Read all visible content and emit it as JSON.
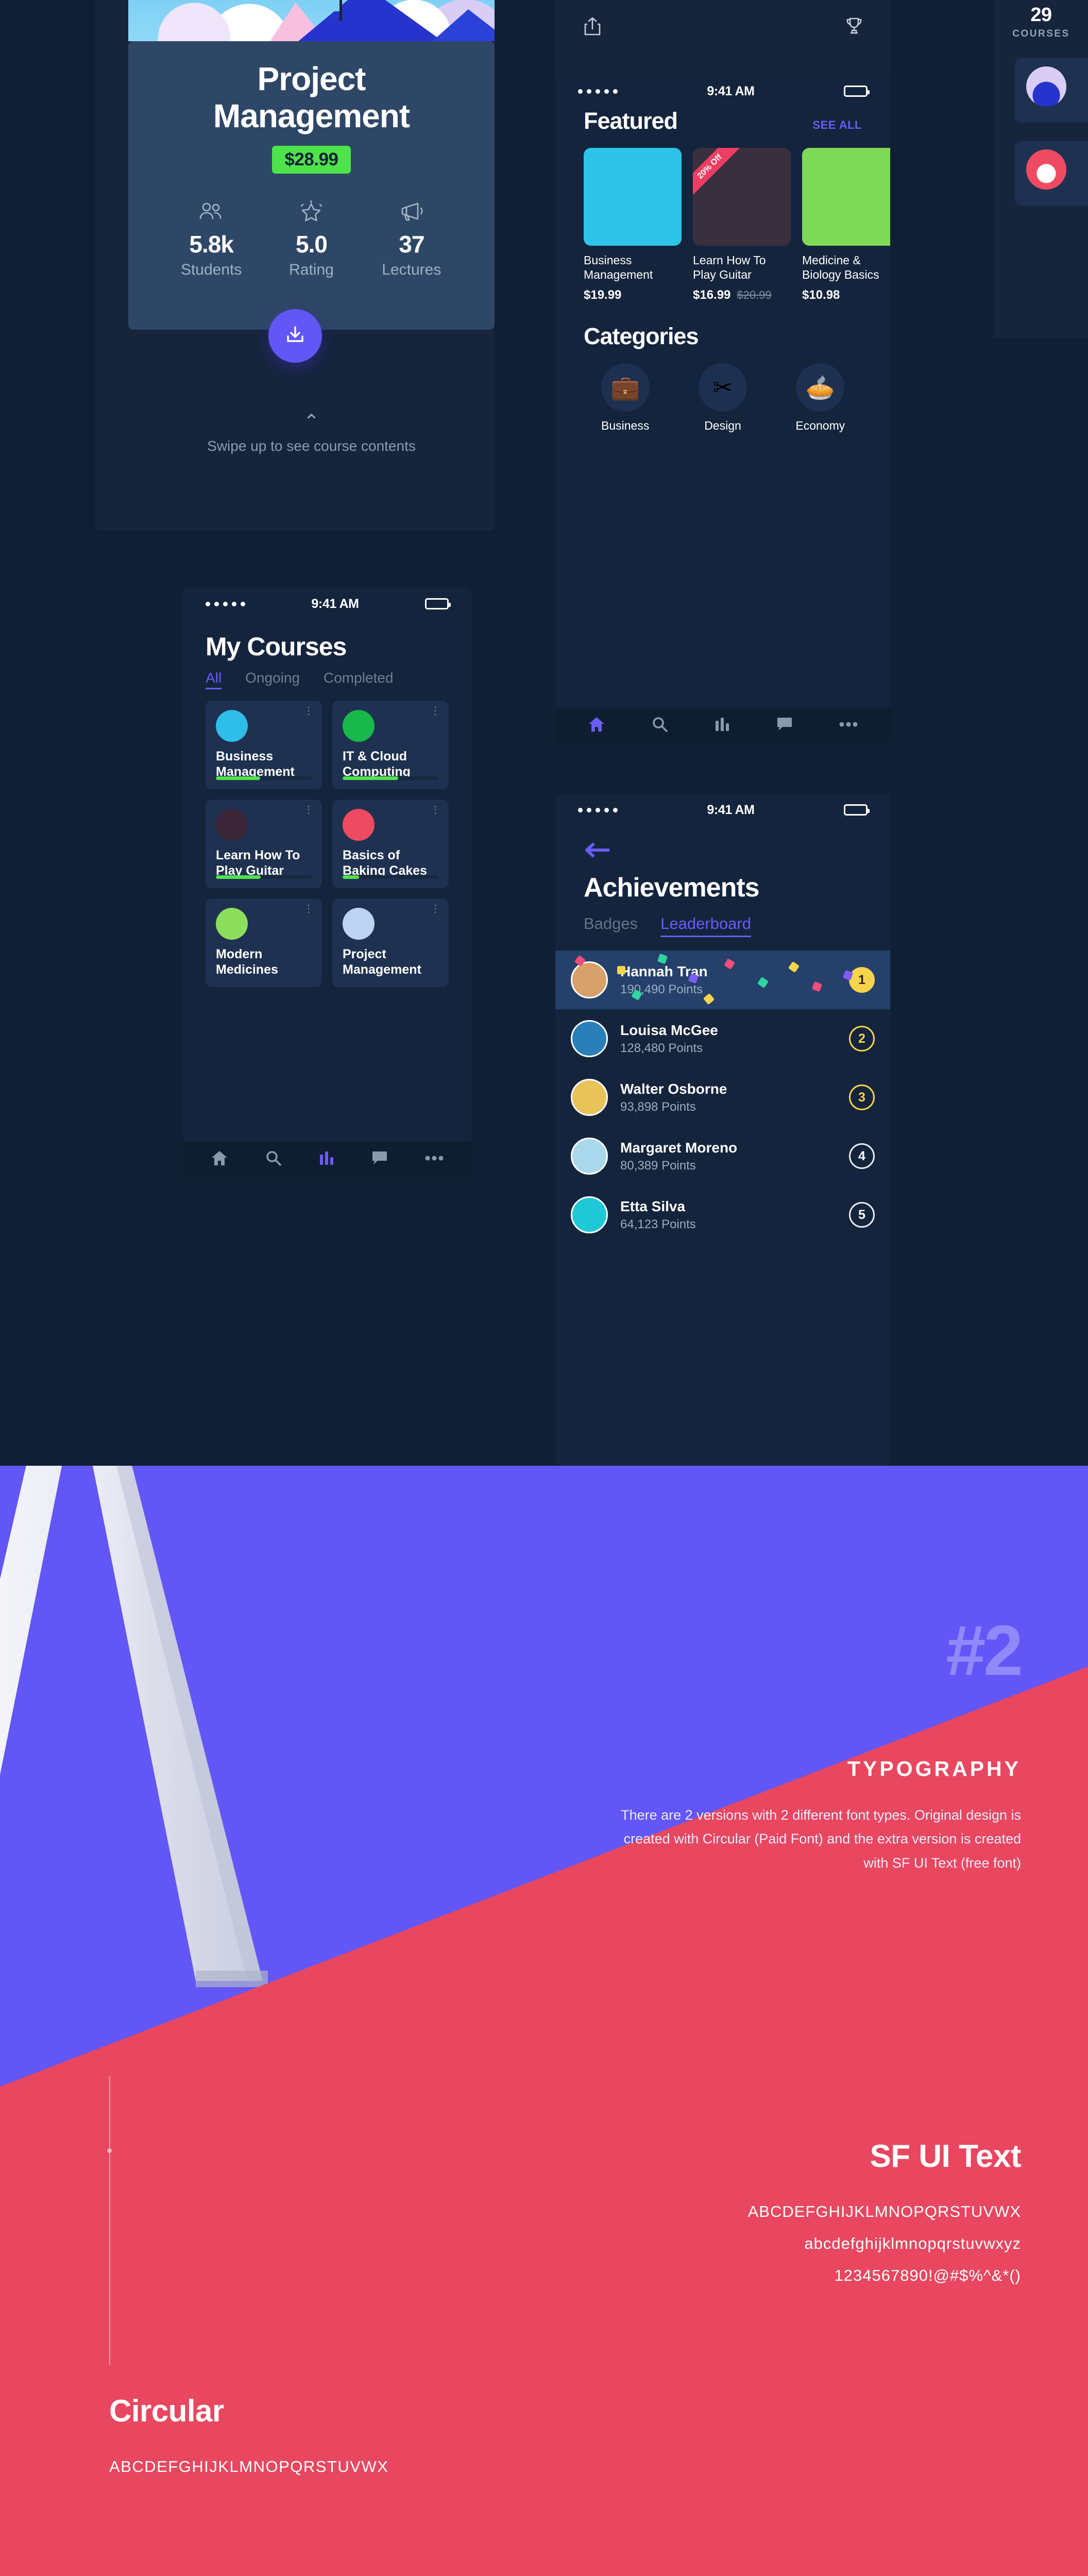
{
  "course_detail": {
    "title": "Project\nManagement",
    "price": "$28.99",
    "stats": [
      {
        "icon": "students-icon",
        "value": "5.8k",
        "label": "Students"
      },
      {
        "icon": "star-rating-icon",
        "value": "5.0",
        "label": "Rating"
      },
      {
        "icon": "megaphone-icon",
        "value": "37",
        "label": "Lectures"
      }
    ],
    "download_icon": "download-icon",
    "swipe_chevron": "⌃",
    "swipe_hint": "Swipe up to see course contents"
  },
  "top_bar": {
    "share_icon": "share-icon",
    "trophy_icon": "trophy-icon"
  },
  "courses_badge": {
    "count": "29",
    "label": "COURSES"
  },
  "status_bar": {
    "time": "9:41 AM"
  },
  "my_courses": {
    "title": "My Courses",
    "tabs": [
      {
        "label": "All",
        "active": true
      },
      {
        "label": "Ongoing",
        "active": false
      },
      {
        "label": "Completed",
        "active": false
      }
    ],
    "cards": [
      {
        "name": "Business Management",
        "progress": 46,
        "color": "#2fbdea"
      },
      {
        "name": "IT & Cloud Computing",
        "progress": 58,
        "color": "#19b84b"
      },
      {
        "name": "Learn How To Play Guitar",
        "progress": 47,
        "color": "#3a2438"
      },
      {
        "name": "Basics of Baking Cakes",
        "progress": 17,
        "color": "#ee4b63"
      },
      {
        "name": "Modern Medicines",
        "progress": 0,
        "color": "#8ede5e"
      },
      {
        "name": "Project Management",
        "progress": 0,
        "color": "#bcd3f2"
      }
    ],
    "tabbar": [
      "home-icon",
      "search-icon",
      "stats-icon",
      "chat-icon",
      "more-icon"
    ],
    "tabbar_active": 2
  },
  "featured": {
    "heading": "Featured",
    "see_all": "SEE ALL",
    "items": [
      {
        "name": "Business\nManagement",
        "price": "$19.99",
        "old_price": "",
        "ribbon": "",
        "color": "#2ec4e8"
      },
      {
        "name": "Learn How To\nPlay Guitar",
        "price": "$16.99",
        "old_price": "$20.99",
        "ribbon": "20% Off",
        "color": "#3a2f3d"
      },
      {
        "name": "Medicine &\nBiology Basics",
        "price": "$10.98",
        "old_price": "",
        "ribbon": "",
        "color": "#7ed957"
      }
    ]
  },
  "categories": {
    "heading": "Categories",
    "items": [
      {
        "label": "Business",
        "glyph": "💼",
        "icon": "briefcase-icon"
      },
      {
        "label": "Design",
        "glyph": "✂",
        "icon": "ruler-pencil-icon"
      },
      {
        "label": "Economy",
        "glyph": "🥧",
        "icon": "pie-chart-icon"
      }
    ],
    "tabbar": [
      "home-icon",
      "search-icon",
      "stats-icon",
      "chat-icon",
      "more-icon"
    ],
    "tabbar_active": 0
  },
  "achievements": {
    "back_icon": "back-arrow-icon",
    "title": "Achievements",
    "tabs": [
      {
        "label": "Badges",
        "active": false
      },
      {
        "label": "Leaderboard",
        "active": true
      }
    ],
    "leaderboard": [
      {
        "rank": "1",
        "name": "Hannah Tran",
        "points": "190,490 Points",
        "av": "#d8a06a",
        "style": "gold"
      },
      {
        "rank": "2",
        "name": "Louisa McGee",
        "points": "128,480 Points",
        "av": "#2a7fb8",
        "style": "outline-gold"
      },
      {
        "rank": "3",
        "name": "Walter Osborne",
        "points": "93,898 Points",
        "av": "#e8c35a",
        "style": "outline-gold"
      },
      {
        "rank": "4",
        "name": "Margaret Moreno",
        "points": "80,389 Points",
        "av": "#a9d8ea",
        "style": "outline-white"
      },
      {
        "rank": "5",
        "name": "Etta Silva",
        "points": "64,123 Points",
        "av": "#1fc8d6",
        "style": "outline-white"
      }
    ]
  },
  "typography": {
    "number": "#2",
    "heading": "TYPOGRAPHY",
    "body": "There are 2 versions with 2 different font types. Original design is created with Circular (Paid Font) and the extra version is created with SF UI Text (free font)",
    "sf": {
      "name": "SF UI Text",
      "upper": "ABCDEFGHIJKLMNOPQRSTUVWX",
      "lower": "abcdefghijklmnopqrstuvwxyz",
      "digits": "1234567890!@#$%^&*()"
    },
    "circular": {
      "name": "Circular",
      "upper": "ABCDEFGHIJKLMNOPQRSTUVWX"
    }
  },
  "colors": {
    "bg_dark": "#101f33",
    "accent_purple": "#6257f6",
    "accent_red": "#e8475f",
    "green": "#4ee34b",
    "gold": "#f6d44b"
  }
}
